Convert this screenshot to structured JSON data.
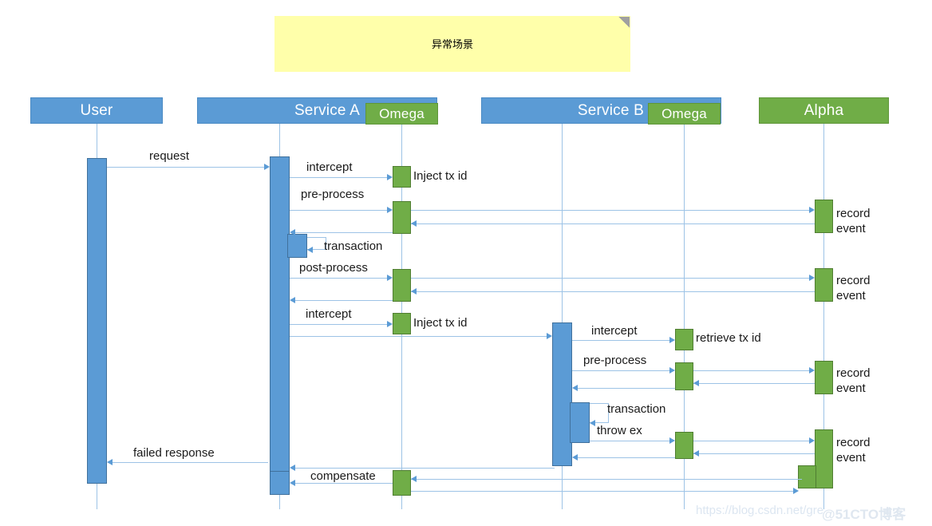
{
  "diagram": {
    "type": "uml-sequence-diagram",
    "title_note": "异常场景",
    "note_translation": "Exception scenario"
  },
  "note": {
    "text": "异常场景"
  },
  "participants": [
    {
      "id": "user",
      "label": "User",
      "color": "#5b9bd5",
      "kind": "blue"
    },
    {
      "id": "service_a",
      "label": "Service A",
      "color": "#5b9bd5",
      "kind": "blue"
    },
    {
      "id": "omega_a",
      "label": "Omega",
      "color": "#70ad47",
      "kind": "green"
    },
    {
      "id": "service_b",
      "label": "Service B",
      "color": "#5b9bd5",
      "kind": "blue"
    },
    {
      "id": "omega_b",
      "label": "Omega",
      "color": "#70ad47",
      "kind": "green"
    },
    {
      "id": "alpha",
      "label": "Alpha",
      "color": "#70ad47",
      "kind": "green"
    }
  ],
  "messages": {
    "request": "request",
    "intercept_1": "intercept",
    "inject_tx_id_1": "Inject tx id",
    "pre_process_1": "pre-process",
    "record_event_1": "record\nevent",
    "transaction_1": "transaction",
    "post_process_1": "post-process",
    "record_event_2": "record\nevent",
    "intercept_2": "intercept",
    "inject_tx_id_2": "Inject tx id",
    "intercept_3": "intercept",
    "retrieve_tx_id": "retrieve tx id",
    "pre_process_2": "pre-process",
    "record_event_3": "record\nevent",
    "transaction_2": "transaction",
    "throw_ex": "throw ex",
    "record_event_4": "record\nevent",
    "failed_response": "failed response",
    "compensate": "compensate"
  },
  "watermarks": {
    "csdn": "https://blog.csdn.net/gre",
    "cto": "@51CTO博客"
  },
  "colors": {
    "blue_fill": "#5b9bd5",
    "blue_border": "#41719c",
    "green_fill": "#70ad47",
    "green_border": "#507e32",
    "note_fill": "#ffffaa",
    "lifeline": "#9dc3e6"
  }
}
